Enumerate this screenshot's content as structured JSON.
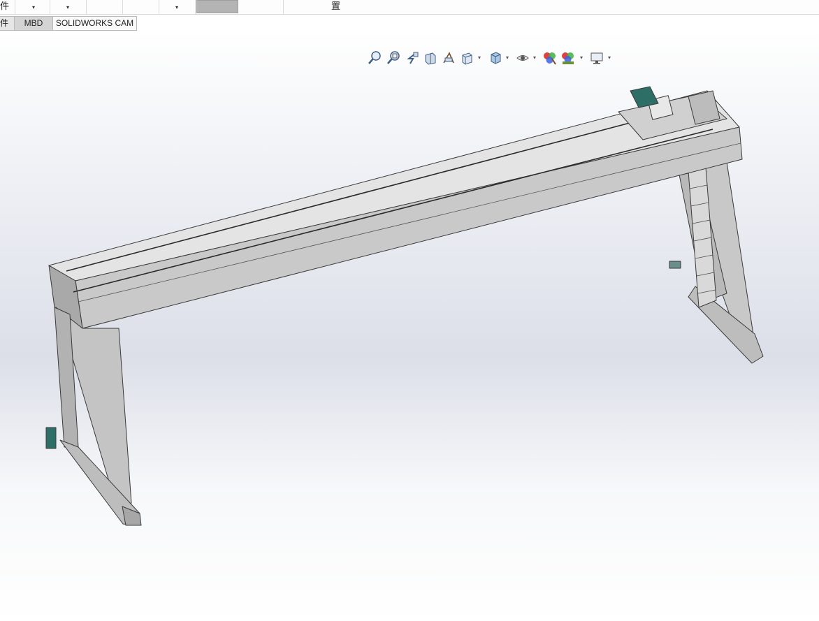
{
  "topbar": {
    "left_label": "件",
    "right_label": "置",
    "dropdown_arrow": "▾"
  },
  "tabs": [
    {
      "label": "件"
    },
    {
      "label": "MBD"
    },
    {
      "label": "SOLIDWORKS CAM"
    }
  ],
  "heads_up_toolbar": {
    "icons": [
      "zoom-to-fit-icon",
      "zoom-to-area-icon",
      "previous-view-icon",
      "section-view-icon",
      "dynamic-annotation-icon",
      "view-orientation-icon",
      "display-style-icon",
      "hide-show-items-icon",
      "edit-appearance-icon",
      "apply-scene-icon",
      "view-settings-icon"
    ],
    "dropdown_arrow": "▾"
  },
  "colors": {
    "steel": "#cfcfcf",
    "steel_dark": "#9d9d9d",
    "edge": "#3a3a3a",
    "motor": "#2d6e67"
  }
}
